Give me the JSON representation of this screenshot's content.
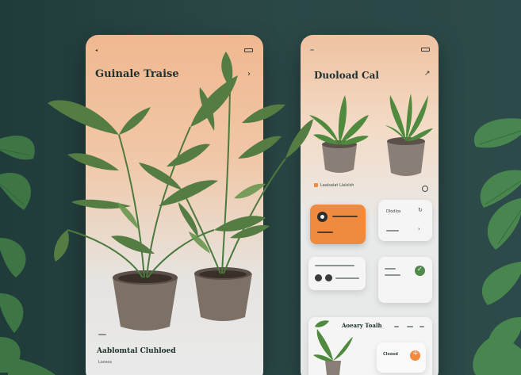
{
  "left_screen": {
    "title": "Guinale Traise",
    "footer_title": "Aablomtal Cluhloed",
    "footer_sub": "Loosos"
  },
  "right_screen": {
    "title": "Duoload Cal",
    "section_label": "Laalsalat Llalslsh",
    "card_white_label": "Dlodlos",
    "bottom_card_title": "Aoeary Toalh",
    "bottom_small_label": "Cloosd"
  },
  "colors": {
    "accent_orange": "#ef8a3e",
    "background": "#2a4746",
    "plant_green": "#4f8a4c"
  }
}
